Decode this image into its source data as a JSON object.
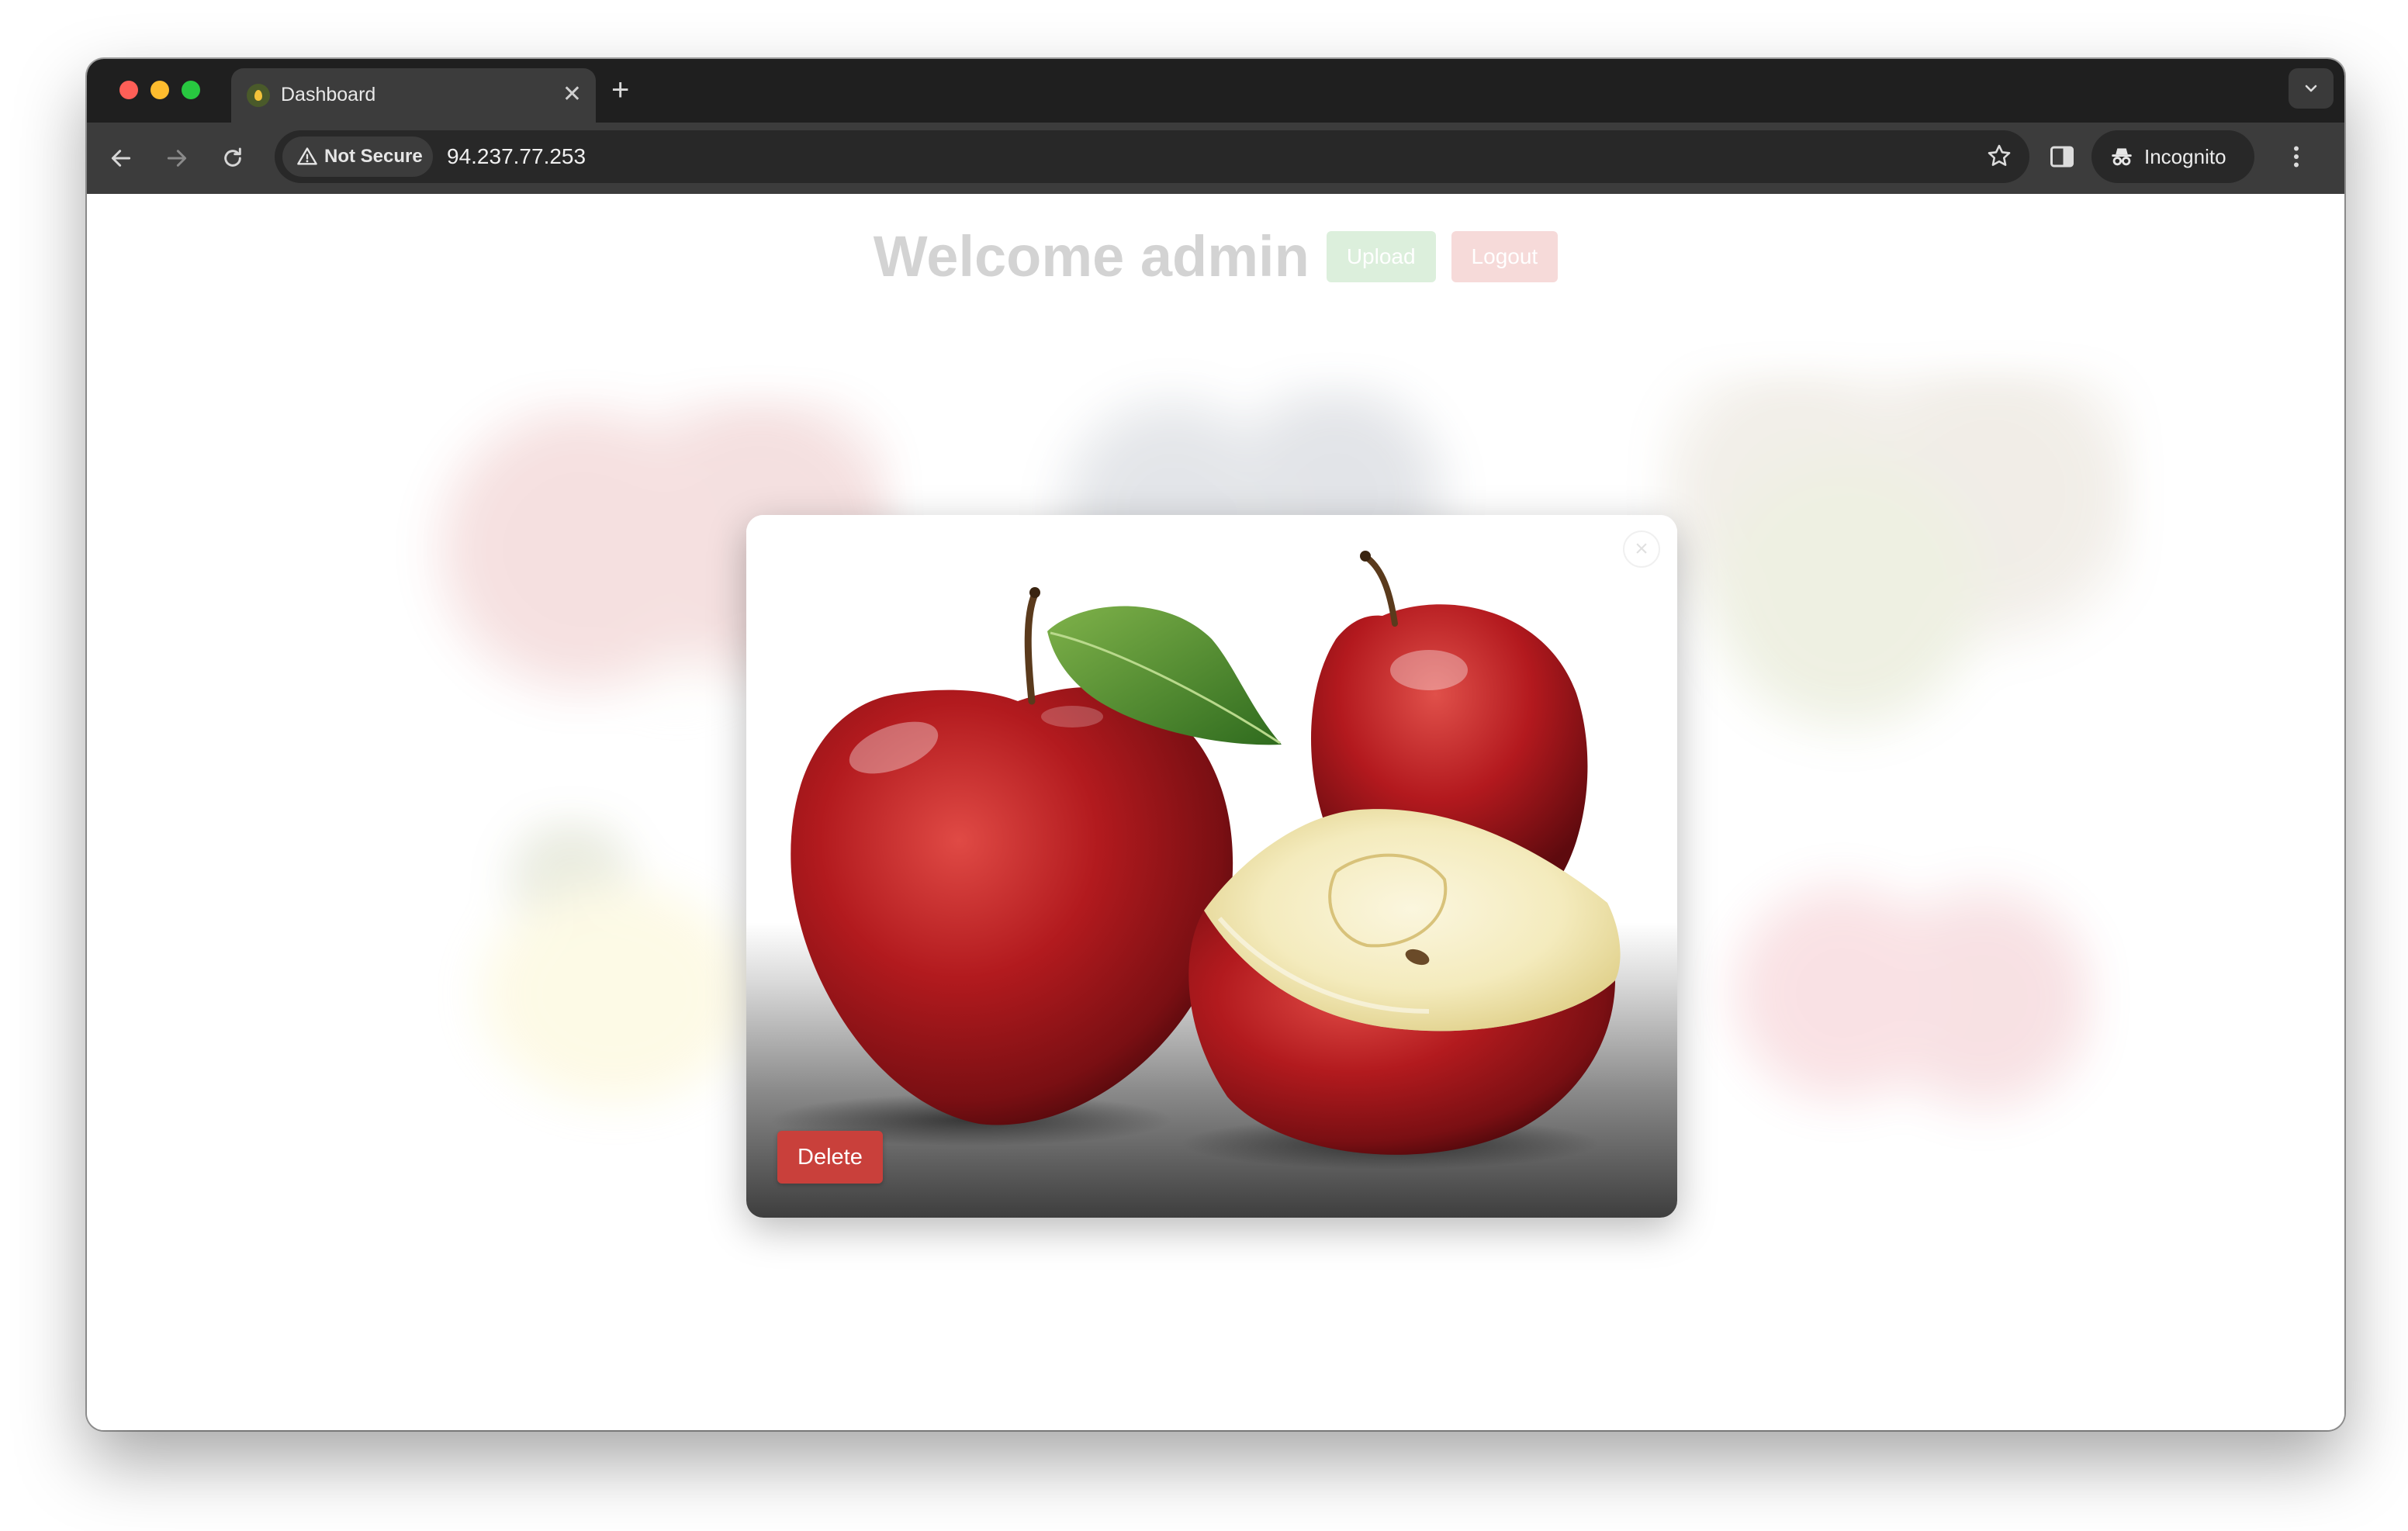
{
  "browser": {
    "tab_title": "Dashboard",
    "new_tab_symbol": "+",
    "close_symbol": "✕",
    "security_label": "Not Secure",
    "url": "94.237.77.253",
    "profile_label": "Incognito",
    "icons": [
      "back-icon",
      "forward-icon",
      "reload-icon",
      "warning-icon",
      "star-icon",
      "side-panel-icon",
      "incognito-icon",
      "menu-icon",
      "chevron-down-icon"
    ]
  },
  "page": {
    "welcome_text": "Welcome admin",
    "upload_label": "Upload",
    "logout_label": "Logout",
    "gallery_images": [
      "apples",
      "blueberries",
      "kiwis",
      "banana",
      "strawberries"
    ]
  },
  "modal": {
    "image": "apples",
    "delete_label": "Delete",
    "close_symbol": "×"
  },
  "colors": {
    "upload": "#5cb85c",
    "logout": "#d9534f",
    "delete": "#c9403b",
    "chrome_dark": "#1f1f1f",
    "toolbar": "#3c3c3c"
  }
}
